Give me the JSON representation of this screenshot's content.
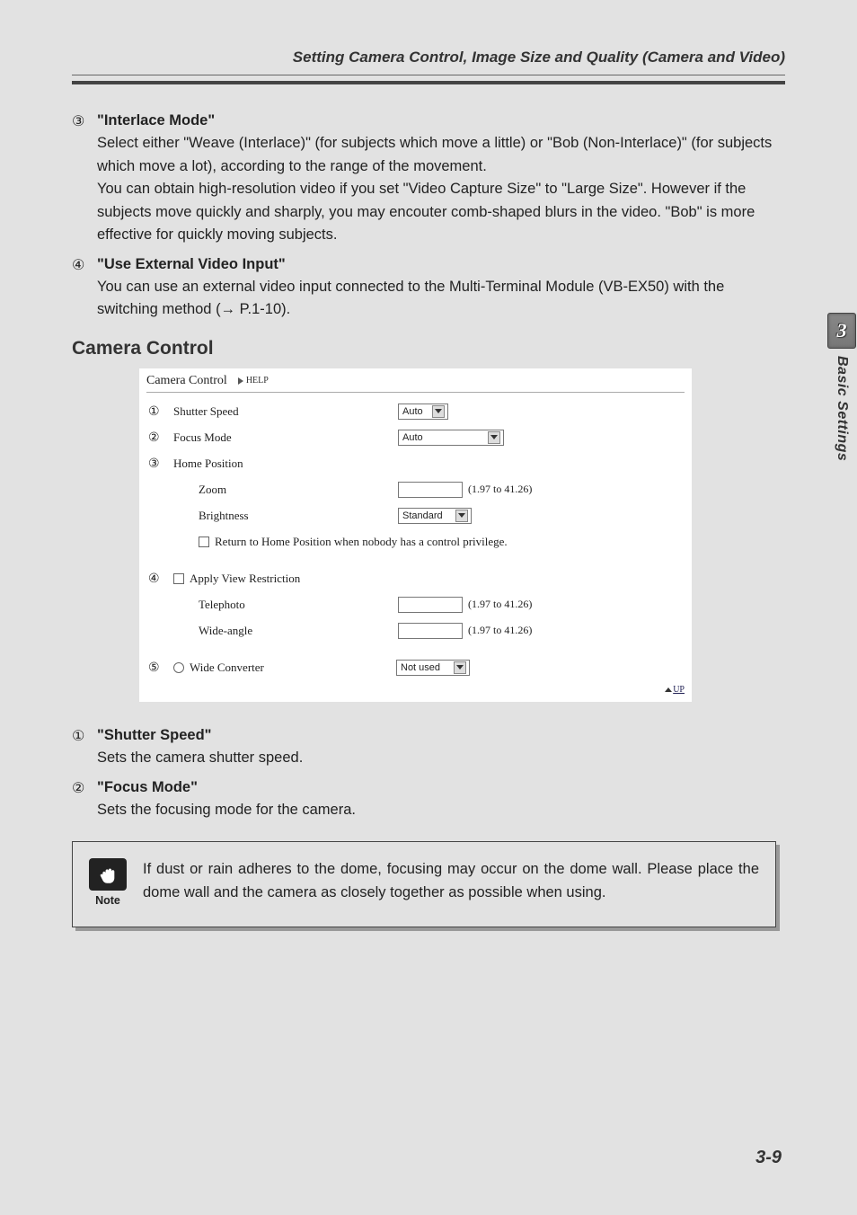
{
  "header": {
    "title": "Setting Camera Control, Image Size and Quality (Camera and Video)"
  },
  "items_top": [
    {
      "num": "③",
      "title": "\"Interlace Mode\"",
      "body": "Select either \"Weave (Interlace)\" (for subjects which move a little) or \"Bob (Non-Interlace)\" (for subjects which move a lot), according to the range of the movement.\nYou can obtain high-resolution video if you set \"Video Capture Size\" to \"Large Size\". However if the subjects move quickly and sharply, you may encouter comb-shaped blurs in the video. \"Bob\" is more effective for quickly moving subjects."
    },
    {
      "num": "④",
      "title": "\"Use External Video Input\"",
      "body": "You can use an external video input connected to the Multi-Terminal Module (VB-EX50) with the switching method (→ P.1-10)."
    }
  ],
  "section": "Camera Control",
  "camera_control": {
    "panel_title": "Camera Control",
    "help_label": "HELP",
    "shutter": {
      "num": "①",
      "label": "Shutter Speed",
      "value": "Auto"
    },
    "focus": {
      "num": "②",
      "label": "Focus Mode",
      "value": "Auto"
    },
    "home": {
      "num": "③",
      "label": "Home Position"
    },
    "zoom": {
      "label": "Zoom",
      "value": "",
      "range": "(1.97 to 41.26)"
    },
    "bright": {
      "label": "Brightness",
      "value": "Standard"
    },
    "return_cb": {
      "label": "Return to Home Position when nobody has a control privilege."
    },
    "apply_view": {
      "num": "④",
      "label": "Apply View Restriction"
    },
    "tele": {
      "label": "Telephoto",
      "value": "",
      "range": "(1.97 to 41.26)"
    },
    "wide": {
      "label": "Wide-angle",
      "value": "",
      "range": "(1.97 to 41.26)"
    },
    "converter": {
      "num": "⑤",
      "label": "Wide Converter",
      "value": "Not used"
    },
    "up_label": "UP"
  },
  "items_bottom": [
    {
      "num": "①",
      "title": "\"Shutter Speed\"",
      "body": "Sets the camera shutter speed."
    },
    {
      "num": "②",
      "title": "\"Focus Mode\"",
      "body": "Sets the focusing mode for the camera."
    }
  ],
  "note": {
    "label": "Note",
    "text": "If dust or rain adheres to the dome, focusing may occur on the dome wall. Please place the dome wall and the camera as closely together as possible when using."
  },
  "side_tab": {
    "chapter": "3",
    "label": "Basic Settings"
  },
  "page_number": "3-9"
}
